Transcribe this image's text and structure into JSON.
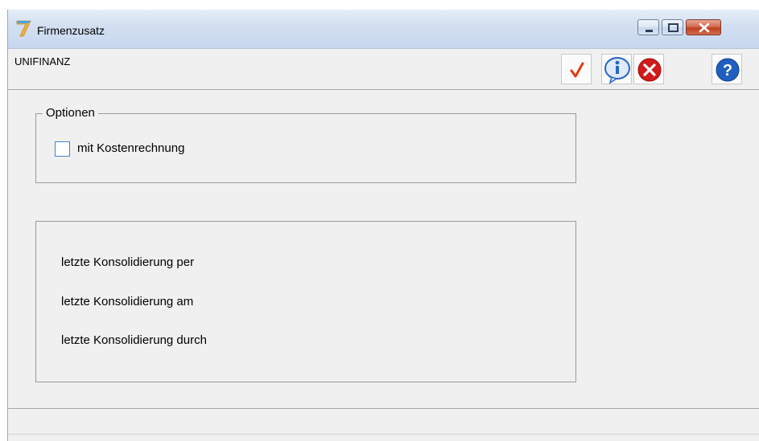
{
  "window": {
    "title": "Firmenzusatz",
    "app_icon": "seven-logo-icon",
    "controls": [
      "minimize-icon",
      "maximize-icon",
      "close-icon"
    ]
  },
  "toolbar": {
    "company": "UNIFINANZ",
    "buttons": [
      "checkmark-icon",
      "info-icon",
      "cancel-icon",
      "help-icon"
    ]
  },
  "options": {
    "legend": "Optionen",
    "checkbox_label": "mit Kostenrechnung",
    "checked": false
  },
  "consolidation": {
    "per_label": "letzte Konsolidierung per",
    "am_label": "letzte Konsolidierung am",
    "durch_label": "letzte Konsolidierung durch"
  },
  "statusbar": {
    "text": ""
  },
  "colors": {
    "titlebar": "#d3e0f1",
    "background": "#f0f0f0",
    "checkmark": "#e23b0e",
    "cancel": "#d11a1a",
    "info": "#2a64c4",
    "help": "#1e5fbf",
    "checkbox_border": "#3b83d6"
  }
}
